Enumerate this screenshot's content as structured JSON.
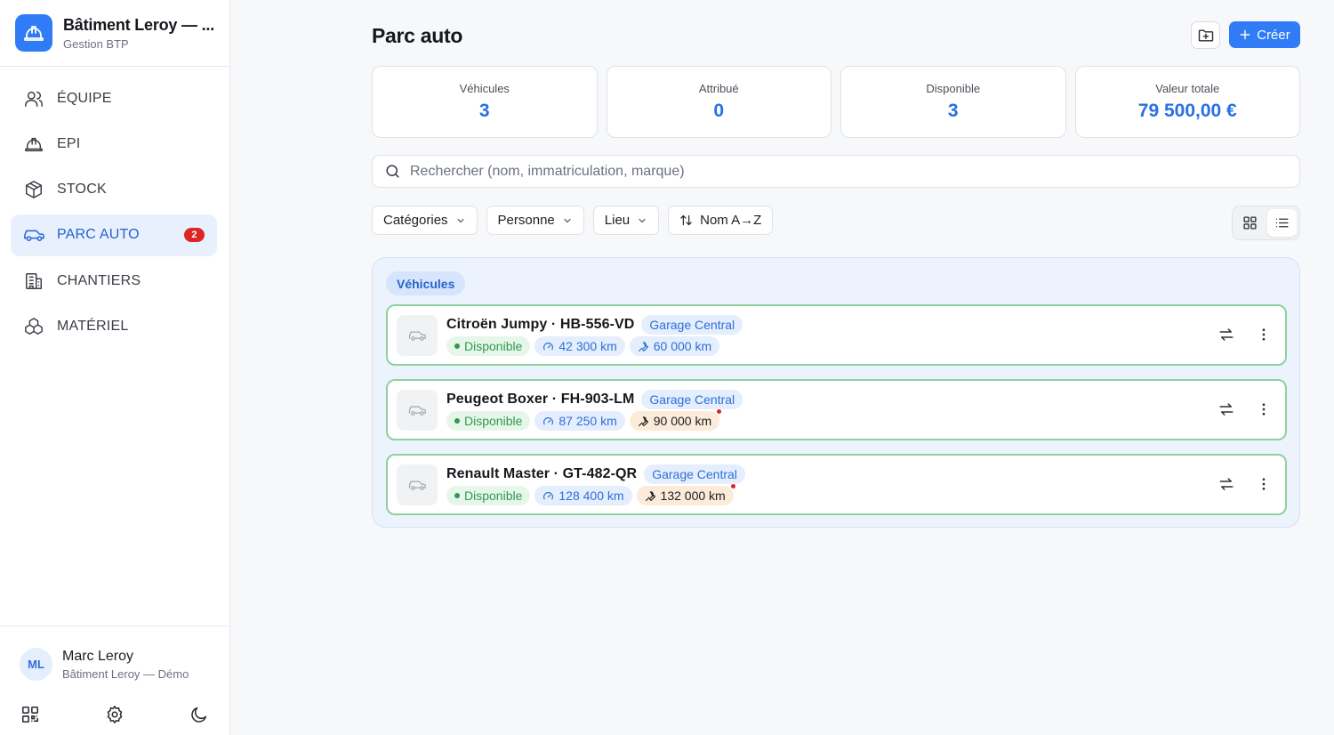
{
  "brand": {
    "name": "Bâtiment Leroy — ...",
    "subtitle": "Gestion BTP"
  },
  "nav": [
    {
      "label": "ÉQUIPE",
      "icon": "users-icon",
      "active": false
    },
    {
      "label": "EPI",
      "icon": "hard-hat-icon",
      "active": false
    },
    {
      "label": "STOCK",
      "icon": "box-icon",
      "active": false
    },
    {
      "label": "PARC AUTO",
      "icon": "car-icon",
      "active": true,
      "badge": "2"
    },
    {
      "label": "CHANTIERS",
      "icon": "building-icon",
      "active": false
    },
    {
      "label": "MATÉRIEL",
      "icon": "boxes-icon",
      "active": false
    }
  ],
  "user": {
    "initials": "ML",
    "name": "Marc Leroy",
    "org": "Bâtiment Leroy — Démo"
  },
  "page": {
    "title": "Parc auto",
    "create_label": "Créer"
  },
  "stats": [
    {
      "label": "Véhicules",
      "value": "3"
    },
    {
      "label": "Attribué",
      "value": "0"
    },
    {
      "label": "Disponible",
      "value": "3"
    },
    {
      "label": "Valeur totale",
      "value": "79 500,00 €"
    }
  ],
  "search": {
    "placeholder": "Rechercher (nom, immatriculation, marque)",
    "value": ""
  },
  "filters": {
    "categories": "Catégories",
    "person": "Personne",
    "location": "Lieu",
    "sort": "Nom A→Z"
  },
  "group": {
    "label": "Véhicules"
  },
  "vehicles": [
    {
      "title": "Citroën Jumpy · HB-556-VD",
      "location": "Garage Central",
      "status": "Disponible",
      "mileage": "42 300 km",
      "service": "60 000 km",
      "service_due": false
    },
    {
      "title": "Peugeot Boxer · FH-903-LM",
      "location": "Garage Central",
      "status": "Disponible",
      "mileage": "87 250 km",
      "service": "90 000 km",
      "service_due": true
    },
    {
      "title": "Renault Master · GT-482-QR",
      "location": "Garage Central",
      "status": "Disponible",
      "mileage": "128 400 km",
      "service": "132 000 km",
      "service_due": true
    }
  ],
  "colors": {
    "accent": "#2f7cf6",
    "stat_value": "#2870e3",
    "status_green": "#2f9a4c",
    "badge_red": "#dc2626",
    "card_border": "#8fd19e"
  }
}
